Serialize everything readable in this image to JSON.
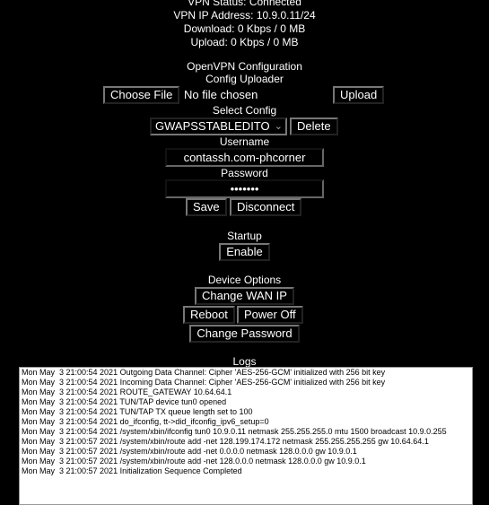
{
  "status": {
    "vpn_status": "VPN Status: Connected",
    "vpn_ip": "VPN IP Address: 10.9.0.11/24",
    "download": "Download: 0 Kbps / 0 MB",
    "upload": "Upload: 0 Kbps / 0 MB"
  },
  "openvpn": {
    "title": "OpenVPN Configuration",
    "uploader_title": "Config Uploader",
    "choose_file_label": "Choose File",
    "no_file_text": "No file chosen",
    "upload_label": "Upload",
    "select_config_title": "Select Config",
    "selected_config": "GWAPSSTABLEDITO",
    "delete_label": "Delete",
    "username_label": "Username",
    "username_value": "contassh.com-phcorner",
    "password_label": "Password",
    "password_value": "•••••••",
    "save_label": "Save",
    "disconnect_label": "Disconnect"
  },
  "startup": {
    "title": "Startup",
    "enable_label": "Enable"
  },
  "device": {
    "title": "Device Options",
    "change_wan_label": "Change WAN IP",
    "reboot_label": "Reboot",
    "power_off_label": "Power Off",
    "change_password_label": "Change Password"
  },
  "logs": {
    "title": "Logs",
    "lines": [
      "Mon May  3 21:00:54 2021 Outgoing Data Channel: Cipher 'AES-256-GCM' initialized with 256 bit key",
      "Mon May  3 21:00:54 2021 Incoming Data Channel: Cipher 'AES-256-GCM' initialized with 256 bit key",
      "Mon May  3 21:00:54 2021 ROUTE_GATEWAY 10.64.64.1",
      "Mon May  3 21:00:54 2021 TUN/TAP device tun0 opened",
      "Mon May  3 21:00:54 2021 TUN/TAP TX queue length set to 100",
      "Mon May  3 21:00:54 2021 do_ifconfig, tt->did_ifconfig_ipv6_setup=0",
      "Mon May  3 21:00:54 2021 /system/xbin/ifconfig tun0 10.9.0.11 netmask 255.255.255.0 mtu 1500 broadcast 10.9.0.255",
      "Mon May  3 21:00:57 2021 /system/xbin/route add -net 128.199.174.172 netmask 255.255.255.255 gw 10.64.64.1",
      "Mon May  3 21:00:57 2021 /system/xbin/route add -net 0.0.0.0 netmask 128.0.0.0 gw 10.9.0.1",
      "Mon May  3 21:00:57 2021 /system/xbin/route add -net 128.0.0.0 netmask 128.0.0.0 gw 10.9.0.1",
      "Mon May  3 21:00:57 2021 Initialization Sequence Completed"
    ]
  }
}
